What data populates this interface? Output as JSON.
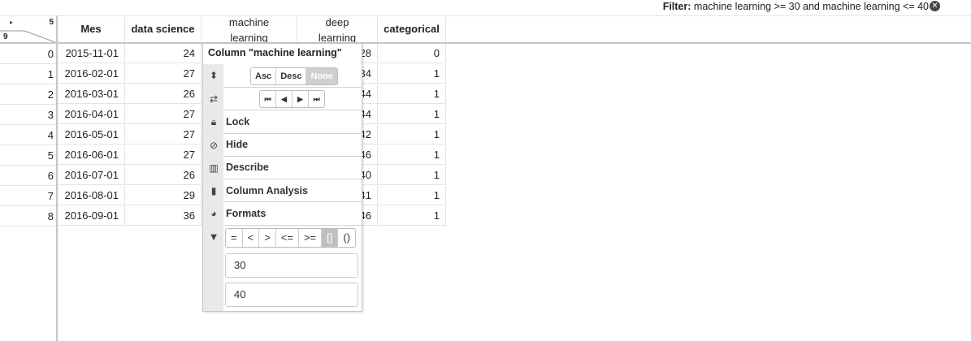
{
  "filter": {
    "label": "Filter:",
    "expression": "machine learning >= 30 and machine learning <= 40",
    "clear_icon": "close-circle-icon"
  },
  "corner": {
    "row_count": "9",
    "col_count": "5",
    "arrow": "▸"
  },
  "columns": [
    "Mes",
    "data science",
    "machine learning",
    "deep learning",
    "categorical"
  ],
  "rows": [
    {
      "idx": "0",
      "mes": "2015-11-01",
      "ds": "24",
      "dl": "28",
      "cat": "0"
    },
    {
      "idx": "1",
      "mes": "2016-02-01",
      "ds": "27",
      "dl": "34",
      "cat": "1"
    },
    {
      "idx": "2",
      "mes": "2016-03-01",
      "ds": "26",
      "dl": "44",
      "cat": "1"
    },
    {
      "idx": "3",
      "mes": "2016-04-01",
      "ds": "27",
      "dl": "44",
      "cat": "1"
    },
    {
      "idx": "4",
      "mes": "2016-05-01",
      "ds": "27",
      "dl": "42",
      "cat": "1"
    },
    {
      "idx": "5",
      "mes": "2016-06-01",
      "ds": "27",
      "dl": "46",
      "cat": "1"
    },
    {
      "idx": "6",
      "mes": "2016-07-01",
      "ds": "26",
      "dl": "40",
      "cat": "1"
    },
    {
      "idx": "7",
      "mes": "2016-08-01",
      "ds": "29",
      "dl": "41",
      "cat": "1"
    },
    {
      "idx": "8",
      "mes": "2016-09-01",
      "ds": "36",
      "dl": "46",
      "cat": "1"
    }
  ],
  "menu": {
    "title": "Column \"machine learning\"",
    "sort": {
      "asc": "Asc",
      "desc": "Desc",
      "none": "None"
    },
    "items": {
      "lock": "Lock",
      "hide": "Hide",
      "describe": "Describe",
      "analysis": "Column Analysis",
      "formats": "Formats"
    },
    "ops": [
      "=",
      "<",
      ">",
      "<=",
      ">=",
      "[]",
      "()"
    ],
    "active_op": "[]",
    "filter_min": "30",
    "filter_max": "40"
  }
}
